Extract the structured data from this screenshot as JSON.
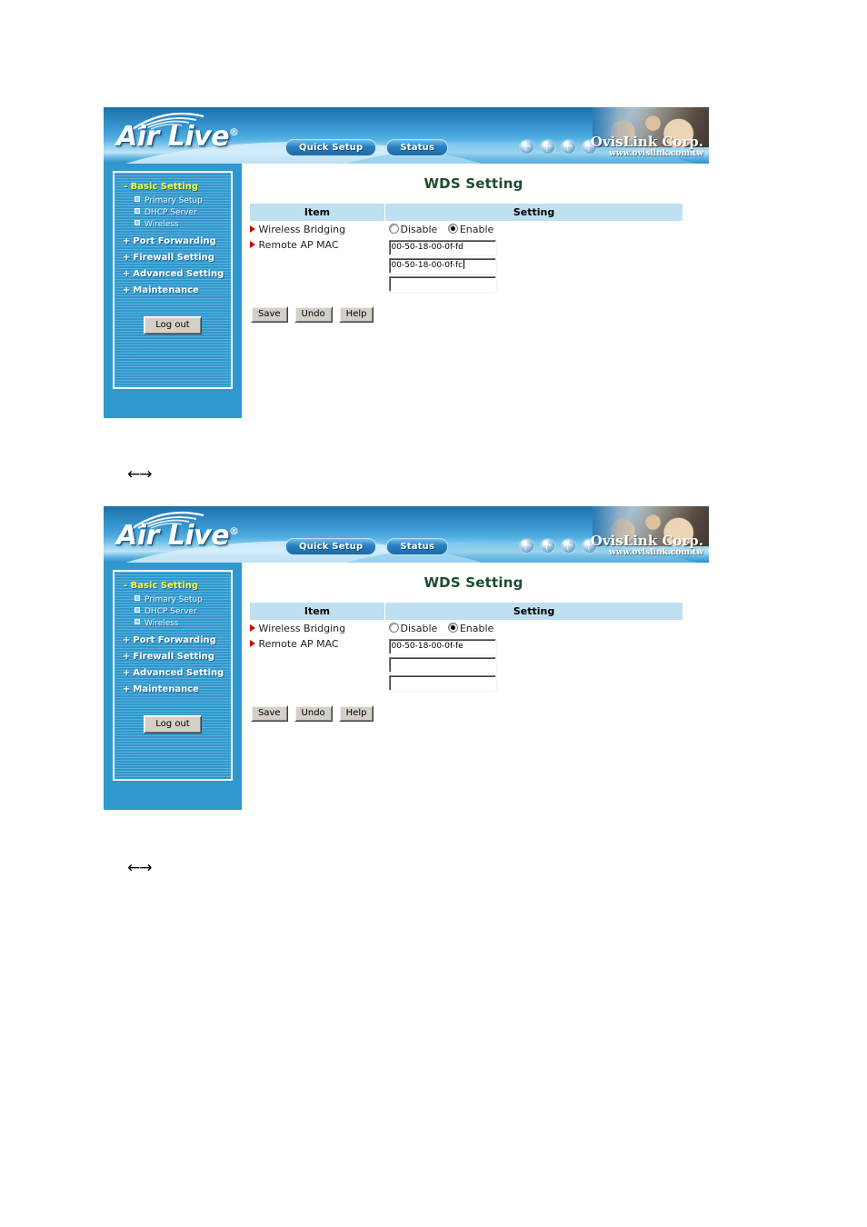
{
  "header": {
    "logo_text": "Air Live",
    "logo_registered": "®",
    "nav_buttons": [
      {
        "label": "Quick Setup"
      },
      {
        "label": "Status"
      }
    ],
    "globe_icons": [
      "globe-icon",
      "globe-icon",
      "globe-icon",
      "globe-icon"
    ],
    "corp_name": "OvisLink Corp.",
    "corp_url": "www.ovislink.com.tw"
  },
  "sidebar": {
    "group_title": "- Basic Setting",
    "sub_items": [
      {
        "label": "Primary Setup"
      },
      {
        "label": "DHCP Server"
      },
      {
        "label": "Wireless"
      }
    ],
    "items": [
      {
        "label": "Port Forwarding",
        "prefix": "+"
      },
      {
        "label": "Firewall Setting",
        "prefix": "+"
      },
      {
        "label": "Advanced Setting",
        "prefix": "+"
      },
      {
        "label": "Maintenance",
        "prefix": "+"
      }
    ],
    "logout_label": "Log out"
  },
  "panel_one": {
    "page_title": "WDS Setting",
    "table_headers": {
      "item": "Item",
      "setting": "Setting"
    },
    "wireless_bridging": {
      "label": "Wireless Bridging",
      "options": [
        {
          "label": "Disable",
          "selected": false
        },
        {
          "label": "Enable",
          "selected": true
        }
      ]
    },
    "remote_ap_mac": {
      "label": "Remote AP MAC",
      "fields": [
        {
          "value": "00-50-18-00-0f-fd",
          "focused": false
        },
        {
          "value": "00-50-18-00-0f-fc",
          "focused": true
        },
        {
          "value": "",
          "focused": false
        }
      ]
    },
    "buttons": [
      {
        "label": "Save"
      },
      {
        "label": "Undo"
      },
      {
        "label": "Help"
      }
    ]
  },
  "panel_two": {
    "page_title": "WDS Setting",
    "table_headers": {
      "item": "Item",
      "setting": "Setting"
    },
    "wireless_bridging": {
      "label": "Wireless Bridging",
      "options": [
        {
          "label": "Disable",
          "selected": false
        },
        {
          "label": "Enable",
          "selected": true
        }
      ]
    },
    "remote_ap_mac": {
      "label": "Remote AP MAC",
      "fields": [
        {
          "value": "00-50-18-00-0f-fe",
          "focused": false
        },
        {
          "value": "",
          "focused": false
        },
        {
          "value": "",
          "focused": false
        }
      ]
    },
    "buttons": [
      {
        "label": "Save"
      },
      {
        "label": "Undo"
      },
      {
        "label": "Help"
      }
    ]
  },
  "annotations": {
    "arrow_one": "←→",
    "arrow_two": "←→"
  },
  "colors": {
    "header_blue": "#2a85c0",
    "sidebar_blue": "#2f98cd",
    "nav_highlight_yellow": "#ffff33",
    "table_header_blue": "#bfe0f0",
    "title_green": "#1b4d2e",
    "bullet_red": "#cc0000"
  }
}
